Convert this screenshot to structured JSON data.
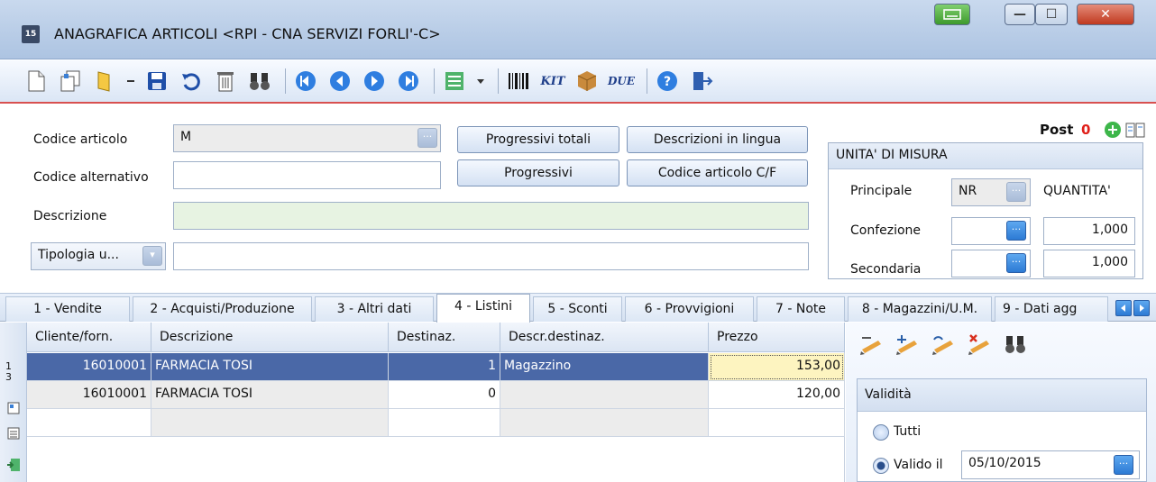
{
  "window": {
    "app_badge": "15",
    "title": "ANAGRAFICA ARTICOLI <RPI - CNA SERVIZI FORLI'-C>",
    "controls": {
      "minimize": "—",
      "maximize": "☐",
      "close": "✕"
    }
  },
  "toolbar": {
    "icons": [
      "new-icon",
      "copy-icon",
      "open-icon",
      "dropdown-arrow-icon",
      "save-icon",
      "undo-icon",
      "delete-icon",
      "find-icon",
      "first-record-icon",
      "previous-record-icon",
      "next-record-icon",
      "last-record-icon",
      "list-view-icon",
      "barcode-icon",
      "kit-icon",
      "package-icon",
      "due-icon",
      "help-icon",
      "exit-icon"
    ],
    "kit_label": "KIT",
    "due_label": "DUE"
  },
  "form": {
    "codice_articolo_label": "Codice articolo",
    "codice_articolo_value": "M",
    "codice_alternativo_label": "Codice alternativo",
    "codice_alternativo_value": "",
    "descrizione_label": "Descrizione",
    "descrizione_value": "",
    "tipologia_label": "Tipologia u...",
    "tipologia_value": "",
    "buttons": {
      "progressivi_totali": "Progressivi totali",
      "descrizioni_lingua": "Descrizioni in lingua",
      "progressivi": "Progressivi",
      "codice_articolo_cf": "Codice articolo C/F"
    },
    "post_label": "Post",
    "post_count": "0"
  },
  "unita_misura": {
    "title": "UNITA' DI MISURA",
    "quantita_header": "QUANTITA'",
    "rows": [
      {
        "label": "Principale",
        "unit": "NR",
        "qty": ""
      },
      {
        "label": "Confezione",
        "unit": "",
        "qty": "1,000"
      },
      {
        "label": "Secondaria",
        "unit": "",
        "qty": "1,000"
      }
    ]
  },
  "tabs": [
    "1 - Vendite",
    "2 - Acquisti/Produzione",
    "3 - Altri dati",
    "4 - Listini",
    "5 - Sconti",
    "6 - Provvigioni",
    "7 - Note",
    "8 - Magazzini/U.M.",
    "9 - Dati agg"
  ],
  "active_tab": "4 - Listini",
  "grid": {
    "columns": [
      "Cliente/forn.",
      "Descrizione",
      "Destinaz.",
      "Descr.destinaz.",
      "Prezzo"
    ],
    "rows": [
      [
        "16010001",
        "FARMACIA TOSI",
        "1",
        "Magazzino",
        "153,00"
      ],
      [
        "16010001",
        "FARMACIA TOSI",
        "0",
        "",
        "120,00"
      ]
    ],
    "row_header_marks": [
      "1",
      "3"
    ]
  },
  "validita": {
    "title": "Validità",
    "option_all": "Tutti",
    "option_valid": "Valido il",
    "date": "05/10/2015",
    "selected": "Valido il"
  },
  "colors": {
    "selection": "#4a68a7",
    "accent_red": "#d85050",
    "post_red": "#e0201a",
    "edit_cell": "#fdf4c0"
  }
}
